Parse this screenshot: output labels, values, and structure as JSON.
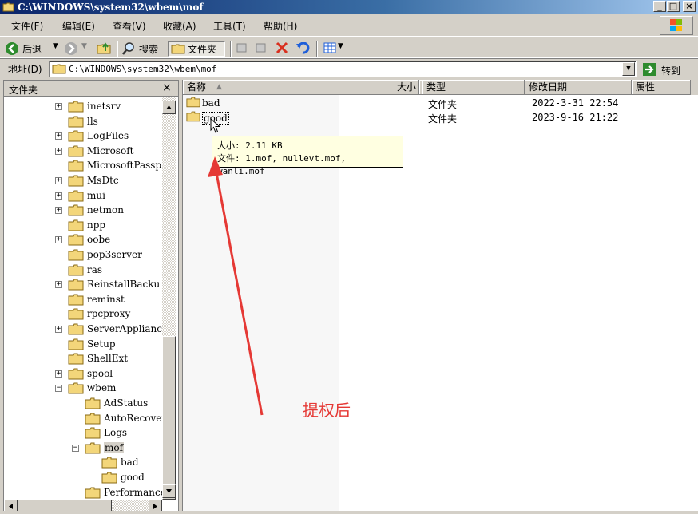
{
  "window": {
    "title": "C:\\WINDOWS\\system32\\wbem\\mof",
    "minimize": "_",
    "maximize": "□",
    "close": "×"
  },
  "menu": [
    {
      "label": "文件(F)"
    },
    {
      "label": "编辑(E)"
    },
    {
      "label": "查看(V)"
    },
    {
      "label": "收藏(A)"
    },
    {
      "label": "工具(T)"
    },
    {
      "label": "帮助(H)"
    }
  ],
  "toolbar": {
    "back": "后退",
    "search": "搜索",
    "folders": "文件夹"
  },
  "address": {
    "label": "地址(D)",
    "value": "C:\\WINDOWS\\system32\\wbem\\mof",
    "go": "转到"
  },
  "left_pane": {
    "title": "文件夹",
    "close": "×",
    "tree": [
      {
        "label": "inetsrv",
        "expander": "+"
      },
      {
        "label": "lls",
        "expander": ""
      },
      {
        "label": "LogFiles",
        "expander": "+"
      },
      {
        "label": "Microsoft",
        "expander": "+"
      },
      {
        "label": "MicrosoftPassp",
        "expander": ""
      },
      {
        "label": "MsDtc",
        "expander": "+"
      },
      {
        "label": "mui",
        "expander": "+"
      },
      {
        "label": "netmon",
        "expander": "+"
      },
      {
        "label": "npp",
        "expander": ""
      },
      {
        "label": "oobe",
        "expander": "+"
      },
      {
        "label": "pop3server",
        "expander": ""
      },
      {
        "label": "ras",
        "expander": ""
      },
      {
        "label": "ReinstallBacku",
        "expander": "+"
      },
      {
        "label": "reminst",
        "expander": ""
      },
      {
        "label": "rpcproxy",
        "expander": ""
      },
      {
        "label": "ServerApplianc",
        "expander": "+"
      },
      {
        "label": "Setup",
        "expander": ""
      },
      {
        "label": "ShellExt",
        "expander": ""
      },
      {
        "label": "spool",
        "expander": "+"
      },
      {
        "label": "wbem",
        "expander": "−"
      },
      {
        "label": "AdStatus",
        "expander": ""
      },
      {
        "label": "AutoRecover",
        "expander": ""
      },
      {
        "label": "Logs",
        "expander": ""
      },
      {
        "label": "mof",
        "expander": "−"
      },
      {
        "label": "bad",
        "expander": ""
      },
      {
        "label": "good",
        "expander": ""
      },
      {
        "label": "Performance",
        "expander": ""
      }
    ]
  },
  "columns": {
    "name": "名称",
    "size": "大小",
    "type": "类型",
    "modified": "修改日期",
    "attributes": "属性"
  },
  "files": [
    {
      "name": "bad",
      "type": "文件夹",
      "modified": "2022-3-31 22:54"
    },
    {
      "name": "good",
      "type": "文件夹",
      "modified": "2023-9-16 21:22"
    }
  ],
  "tooltip": {
    "size_line": "大小: 2.11 KB",
    "files_line": "文件: 1.mof, nullevt.mof, wanli.mof"
  },
  "annotation": {
    "text": "提权后",
    "color": "#e53935"
  }
}
